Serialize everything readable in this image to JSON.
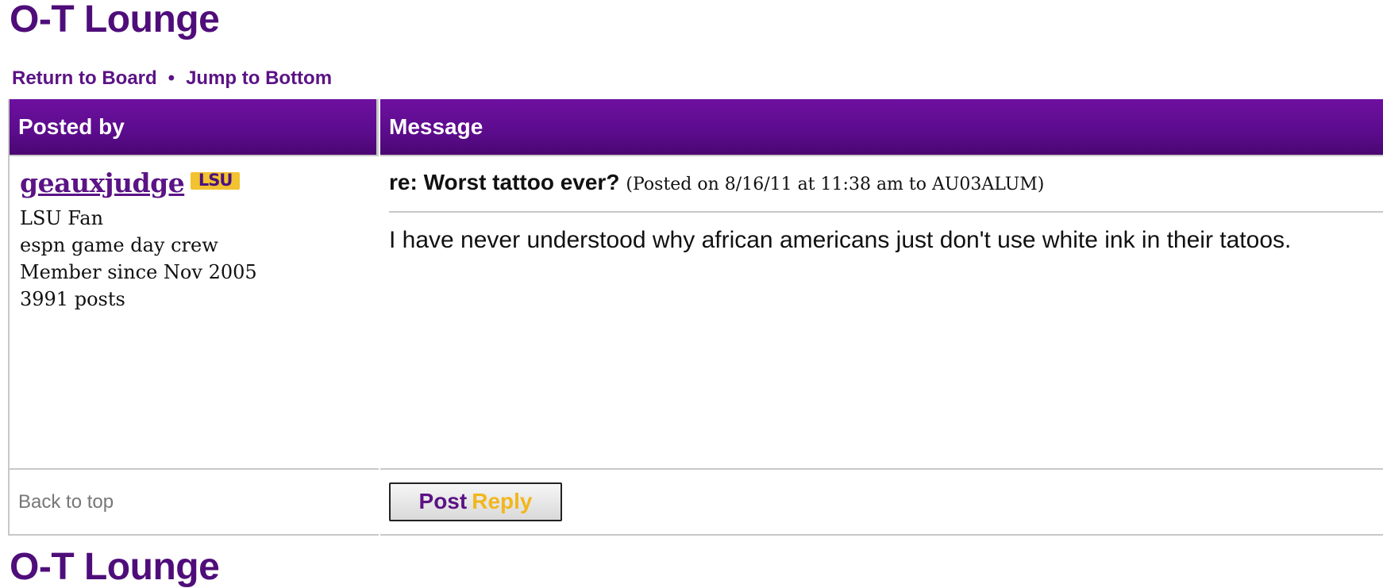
{
  "board": {
    "title": "O-T Lounge",
    "bottom_title": "O-T Lounge"
  },
  "nav": {
    "return_label": "Return to Board",
    "separator": "•",
    "jump_label": "Jump to Bottom"
  },
  "table": {
    "header_left": "Posted by",
    "header_right": "Message"
  },
  "post": {
    "username": "geauxjudge",
    "badge_text": "LSU",
    "user_lines": [
      "LSU Fan",
      "espn game day crew",
      "Member since Nov 2005",
      "3991 posts"
    ],
    "subject": "re: Worst tattoo ever?",
    "meta": "(Posted on 8/16/11 at 11:38 am to AU03ALUM)",
    "body": "I have never understood why african americans just don't use white ink in their tatoos."
  },
  "footer": {
    "back_to_top": "Back to top",
    "post_label": "Post",
    "reply_label": "Reply"
  },
  "colors": {
    "brand_purple": "#5b1385",
    "header_purple": "#6e0fa0",
    "lsu_gold": "#f2c230",
    "border_gray": "#c8c8c8"
  },
  "icons": {
    "team_badge": "lsu-badge-icon"
  }
}
